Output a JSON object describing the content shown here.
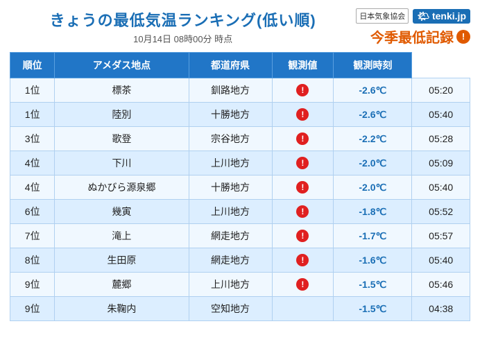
{
  "header": {
    "main_title": "きょうの最低気温ランキング(低い順)",
    "subtitle": "10月14日  08時00分 時点",
    "jma_label": "日本気象協会",
    "tenki_label": "tenki.jp",
    "season_record_label": "今季最低記録"
  },
  "table": {
    "columns": [
      "順位",
      "アメダス地点",
      "都道府県",
      "観測値",
      "観測時刻"
    ],
    "rows": [
      {
        "rank": "1位",
        "station": "標茶",
        "prefecture": "釧路地方",
        "alert": true,
        "temp": "-2.6℃",
        "time": "05:20"
      },
      {
        "rank": "1位",
        "station": "陸別",
        "prefecture": "十勝地方",
        "alert": true,
        "temp": "-2.6℃",
        "time": "05:40"
      },
      {
        "rank": "3位",
        "station": "歌登",
        "prefecture": "宗谷地方",
        "alert": true,
        "temp": "-2.2℃",
        "time": "05:28"
      },
      {
        "rank": "4位",
        "station": "下川",
        "prefecture": "上川地方",
        "alert": true,
        "temp": "-2.0℃",
        "time": "05:09"
      },
      {
        "rank": "4位",
        "station": "ぬかびら源泉郷",
        "prefecture": "十勝地方",
        "alert": true,
        "temp": "-2.0℃",
        "time": "05:40"
      },
      {
        "rank": "6位",
        "station": "幾寅",
        "prefecture": "上川地方",
        "alert": true,
        "temp": "-1.8℃",
        "time": "05:52"
      },
      {
        "rank": "7位",
        "station": "滝上",
        "prefecture": "網走地方",
        "alert": true,
        "temp": "-1.7℃",
        "time": "05:57"
      },
      {
        "rank": "8位",
        "station": "生田原",
        "prefecture": "網走地方",
        "alert": true,
        "temp": "-1.6℃",
        "time": "05:40"
      },
      {
        "rank": "9位",
        "station": "麓郷",
        "prefecture": "上川地方",
        "alert": true,
        "temp": "-1.5℃",
        "time": "05:46"
      },
      {
        "rank": "9位",
        "station": "朱鞠内",
        "prefecture": "空知地方",
        "alert": false,
        "temp": "-1.5℃",
        "time": "04:38"
      }
    ]
  }
}
